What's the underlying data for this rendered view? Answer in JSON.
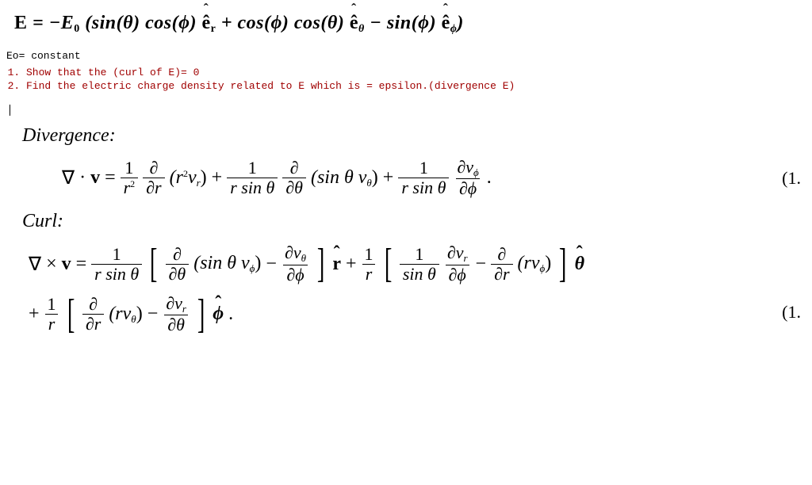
{
  "main_eq": {
    "lhs": "E",
    "eq": "=",
    "neg": "−",
    "E0": "E",
    "E0sub": "0",
    "open": "(",
    "t1_sin": "sin",
    "t1_arg": "(θ)",
    "t1_cos": "cos",
    "t1_arg2": "(ϕ)",
    "u_er": "ê",
    "u_er_sub": "r",
    "plus": "+",
    "t2_cos": "cos",
    "t2_arg": "(ϕ)",
    "t2_cos2": "cos",
    "t2_arg2": "(θ)",
    "u_eth": "ê",
    "u_eth_sub": "θ",
    "minus": "−",
    "t3_sin": "sin",
    "t3_arg": "(ϕ)",
    "u_eph": "ê",
    "u_eph_sub": "ϕ",
    "close": ")"
  },
  "note_e0": "Eo= constant",
  "problems": [
    "Show that the (curl of E)= 0",
    "Find the electric charge density related to E which is = epsilon.(divergence E)"
  ],
  "divergence_label": "Divergence:",
  "curl_label": "Curl:",
  "eqnum1": "(1.",
  "eqnum2": "(1.",
  "div": {
    "nabla": "∇",
    "dot": "·",
    "v": "v",
    "eq": "=",
    "f1n": "1",
    "f1d_a": "r",
    "f1d_sup": "2",
    "d_dr_n": "∂",
    "d_dr_d": "∂r",
    "paren1": "(r",
    "paren1_sup": "2",
    "paren1_v": "v",
    "paren1_sub": "r",
    "paren1_close": ")",
    "plus1": "+",
    "f2n": "1",
    "f2d": "r sin θ",
    "d_dth_n": "∂",
    "d_dth_d": "∂θ",
    "paren2_pre": "(sin θ ",
    "paren2_v": "v",
    "paren2_sub": "θ",
    "paren2_close": ")",
    "plus2": "+",
    "f3n": "1",
    "f3d": "r sin θ",
    "f3b_n": "∂v",
    "f3b_n_sub": "ϕ",
    "f3b_d": "∂ϕ",
    "period": "."
  },
  "curl": {
    "nabla": "∇",
    "cross": "×",
    "v": "v",
    "eq": "=",
    "pre_n": "1",
    "pre_d": "r sin θ",
    "t1a_n": "∂",
    "t1a_d": "∂θ",
    "t1a_body": "(sin θ v",
    "t1a_sub": "ϕ",
    "t1a_close": ")",
    "minus1": "−",
    "t1b_n": "∂v",
    "t1b_n_sub": "θ",
    "t1b_d": "∂ϕ",
    "rhat": "r",
    "plus1": "+",
    "pre2_n": "1",
    "pre2_d": "r",
    "t2a_pre_n": "1",
    "t2a_pre_d": "sin θ",
    "t2a_n": "∂v",
    "t2a_n_sub": "r",
    "t2a_d": "∂ϕ",
    "minus2": "−",
    "t2b_n": "∂",
    "t2b_d": "∂r",
    "t2b_body": "(rv",
    "t2b_sub": "ϕ",
    "t2b_close": ")",
    "thhat": "θ",
    "plus2": "+",
    "pre3_n": "1",
    "pre3_d": "r",
    "t3a_n": "∂",
    "t3a_d": "∂r",
    "t3a_body": "(rv",
    "t3a_sub": "θ",
    "t3a_close": ")",
    "minus3": "−",
    "t3b_n": "∂v",
    "t3b_n_sub": "r",
    "t3b_d": "∂θ",
    "phhat": "ϕ",
    "period": "."
  }
}
